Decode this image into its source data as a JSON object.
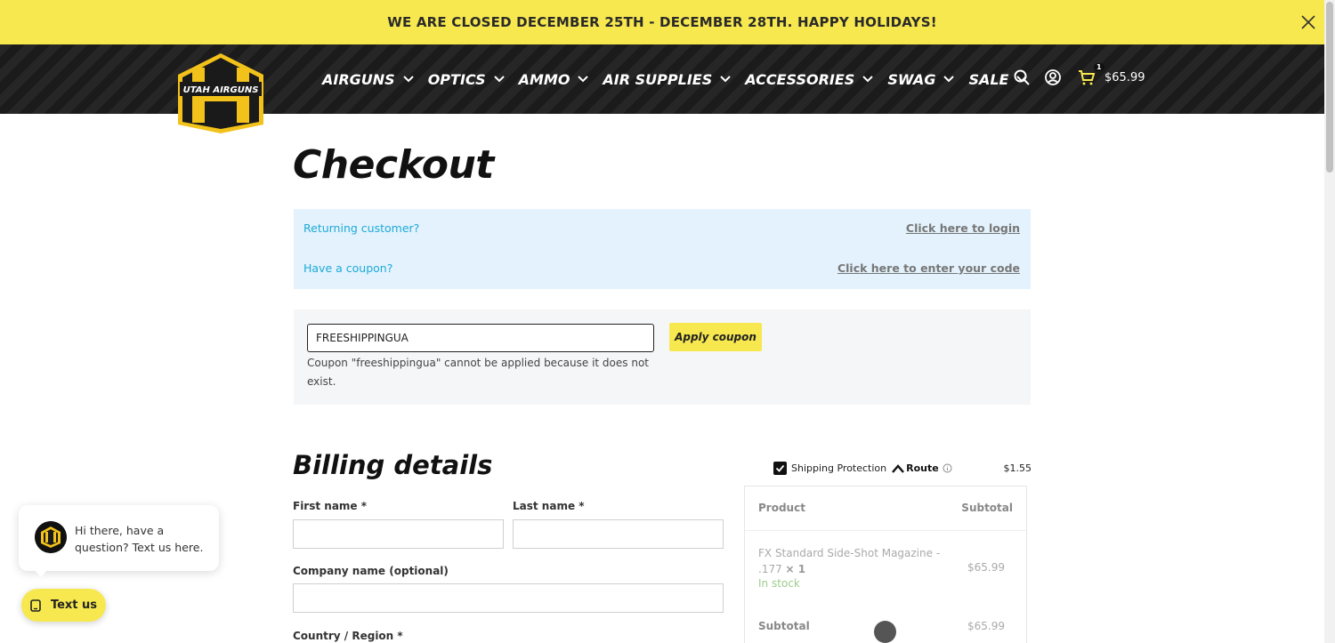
{
  "announcement": {
    "text": "WE ARE CLOSED DECEMBER 25TH - DECEMBER 28TH. HAPPY HOLIDAYS!",
    "close_icon": "close-icon"
  },
  "header": {
    "logo_text": "UTAH AIRGUNS",
    "nav": [
      {
        "label": "AIRGUNS"
      },
      {
        "label": "OPTICS"
      },
      {
        "label": "AMMO"
      },
      {
        "label": "AIR SUPPLIES"
      },
      {
        "label": "ACCESSORIES"
      },
      {
        "label": "SWAG"
      },
      {
        "label": "SALE"
      }
    ],
    "icons": [
      "search-icon",
      "account-icon",
      "cart-icon"
    ],
    "cart_count": "1",
    "cart_total": "$65.99",
    "accent_color": "#f7e84f"
  },
  "checkout": {
    "title": "Checkout",
    "returning_question": "Returning customer?",
    "login_link": "Click here to login",
    "coupon_question": "Have a coupon?",
    "coupon_link": "Click here to enter your code",
    "coupon_value": "FREESHIPPINGUA",
    "apply_label": "Apply coupon",
    "coupon_error": "Coupon \"freeshippingua\" cannot be applied because it does not exist."
  },
  "billing": {
    "title": "Billing details",
    "first_name_label": "First name *",
    "last_name_label": "Last name *",
    "company_label": "Company name (optional)",
    "country_label": "Country / Region *"
  },
  "order": {
    "shipping_protection_label": "Shipping Protection",
    "shipping_protection_checked": true,
    "route_label": "Route",
    "shipping_protection_price": "$1.55",
    "head_product": "Product",
    "head_subtotal": "Subtotal",
    "item_name": "FX Standard Side-Shot Magazine - .177",
    "item_qty": "× 1",
    "item_stock": "In stock",
    "item_price": "$65.99",
    "subtotal_label": "Subtotal",
    "subtotal_price": "$65.99"
  },
  "chat": {
    "message": "Hi there, have a question? Text us here.",
    "button_label": "Text us"
  }
}
